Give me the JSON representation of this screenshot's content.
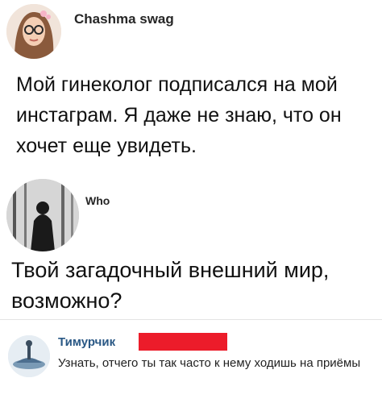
{
  "post1": {
    "username": "Chashma swag",
    "text": "Мой гинеколог подписался на мой инстаграм. Я даже не знаю, что он хочет еще увидеть."
  },
  "post2": {
    "username": "Who",
    "text": "Твой загадочный внешний мир, возможно?"
  },
  "comment": {
    "author": "Тимурчик",
    "redaction_color": "#ec1c2a",
    "text": "Узнать, отчего ты так часто к нему ходишь на приёмы"
  }
}
